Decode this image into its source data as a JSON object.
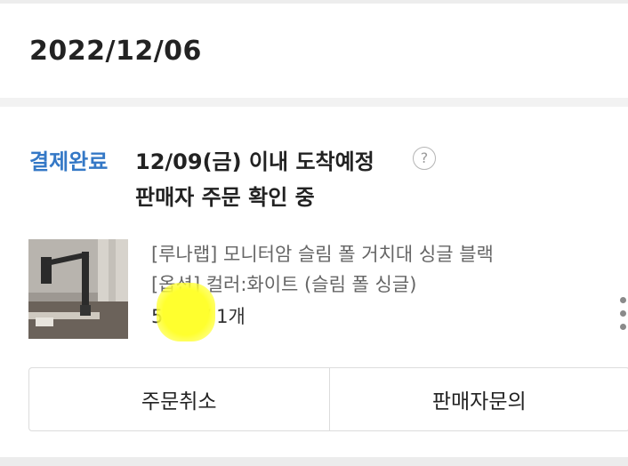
{
  "order_date": "2022/12/06",
  "order": {
    "status": "결제완료",
    "arrival": "12/09(금) 이내 도착예정",
    "help_icon": "question-circle-icon",
    "seller_status": "판매자 주문 확인 중",
    "product": {
      "name": "[루나랩] 모니터암 슬림 폴 거치대 싱글 블랙",
      "option": "[옵션] 컬러:화이트 (슬림 폴 싱글)",
      "price_quantity": "57  원 / 1개",
      "thumbnail_icon": "monitor-arm-photo"
    },
    "more_icon": "vertical-ellipsis-icon",
    "buttons": {
      "cancel": "주문취소",
      "inquiry": "판매자문의"
    }
  },
  "colors": {
    "status_blue": "#3478c6",
    "highlight_yellow": "#ffff2e"
  }
}
